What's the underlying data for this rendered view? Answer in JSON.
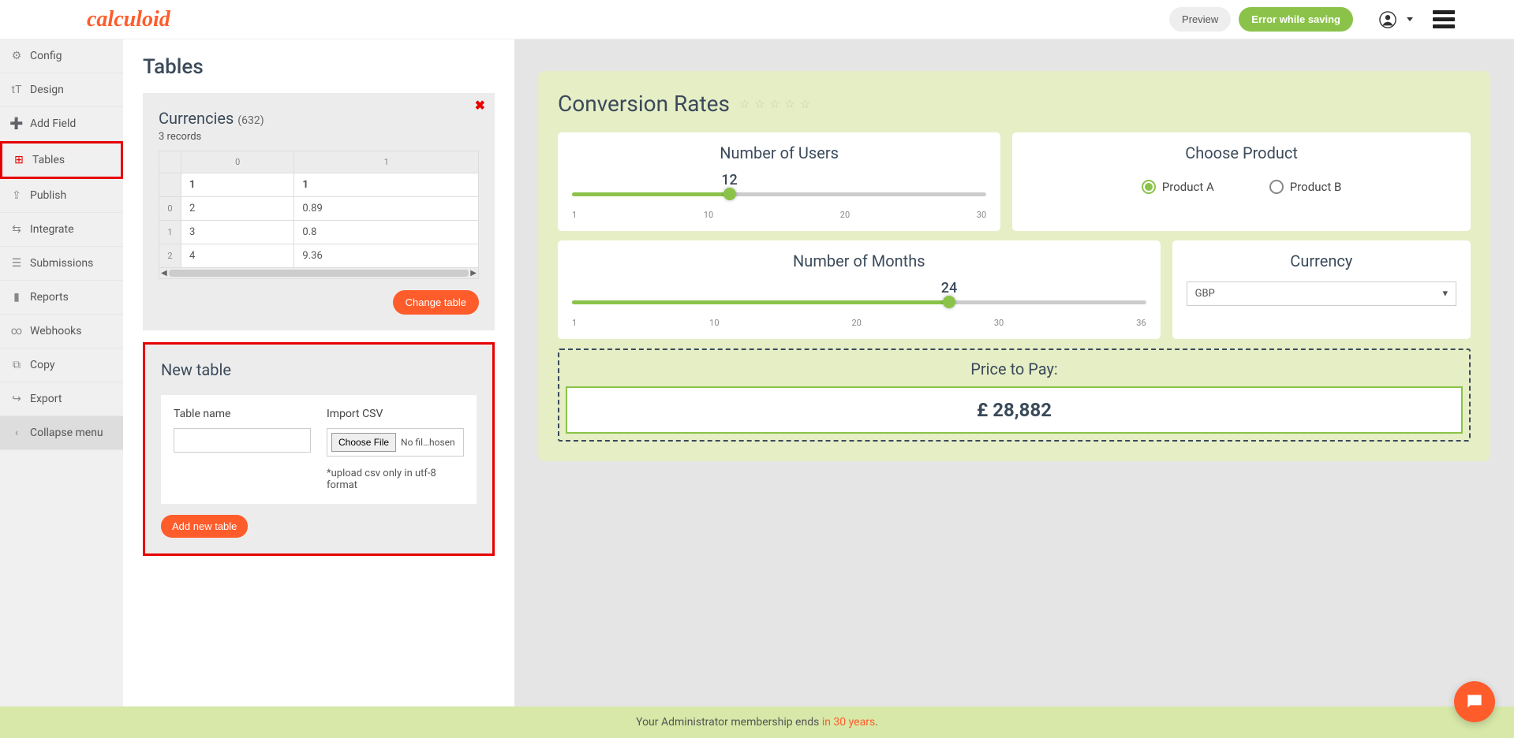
{
  "header": {
    "logo": "calculoid",
    "preview_btn": "Preview",
    "error_btn": "Error while saving"
  },
  "sidebar": {
    "items": [
      {
        "icon": "⚙",
        "label": "Config"
      },
      {
        "icon": "tT",
        "label": "Design"
      },
      {
        "icon": "➕",
        "label": "Add Field"
      },
      {
        "icon": "⊞",
        "label": "Tables",
        "active": true
      },
      {
        "icon": "⇪",
        "label": "Publish"
      },
      {
        "icon": "⇆",
        "label": "Integrate"
      },
      {
        "icon": "☰",
        "label": "Submissions"
      },
      {
        "icon": "▮",
        "label": "Reports"
      },
      {
        "icon": "∞",
        "label": "Webhooks"
      },
      {
        "icon": "⧉",
        "label": "Copy"
      },
      {
        "icon": "↪",
        "label": "Export"
      }
    ],
    "collapse": {
      "icon": "‹",
      "label": "Collapse menu"
    }
  },
  "editor": {
    "title": "Tables",
    "currencies": {
      "name": "Currencies",
      "count": "(632)",
      "records": "3 records",
      "col_headers": [
        "0",
        "1"
      ],
      "row_headers": [
        "",
        "0",
        "1",
        "2"
      ],
      "rows": [
        [
          "1",
          "1"
        ],
        [
          "2",
          "0.89"
        ],
        [
          "3",
          "0.8"
        ],
        [
          "4",
          "9.36"
        ]
      ],
      "change_btn": "Change table"
    },
    "new_table": {
      "title": "New table",
      "name_label": "Table name",
      "import_label": "Import CSV",
      "choose_file": "Choose File",
      "no_file": "No fil…hosen",
      "hint": "*upload csv only in utf-8 format",
      "add_btn": "Add new table"
    }
  },
  "calc": {
    "title": "Conversion Rates",
    "users": {
      "title": "Number of Users",
      "value": "12",
      "min": "1",
      "ticks": [
        "1",
        "10",
        "20",
        "30"
      ],
      "pct": 38
    },
    "product": {
      "title": "Choose Product",
      "a": "Product A",
      "b": "Product B"
    },
    "months": {
      "title": "Number of Months",
      "value": "24",
      "ticks": [
        "1",
        "10",
        "20",
        "30",
        "36"
      ],
      "pct": 65.7
    },
    "currency": {
      "title": "Currency",
      "value": "GBP"
    },
    "price": {
      "title": "Price to Pay:",
      "value": "£ 28,882"
    }
  },
  "footer": {
    "prefix": "Your Administrator membership ends ",
    "highlight": "in 30 years",
    "suffix": "."
  }
}
